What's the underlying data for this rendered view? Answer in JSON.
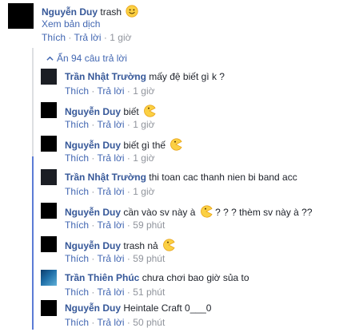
{
  "top_comment": {
    "author": "Nguyễn Duy",
    "text": "trash",
    "translate": "Xem bản dịch",
    "actions": {
      "like": "Thích",
      "reply": "Trả lời",
      "sep": "·",
      "time": "1 giờ"
    }
  },
  "thread": {
    "hidden_replies": "Ẩn 94 câu trả lời",
    "replies": [
      {
        "author": "Trần Nhật Trường",
        "text": "mấy đệ biết gì k ?",
        "emoji": "",
        "like": "Thích",
        "reply": "Trả lời",
        "time": "1 giờ"
      },
      {
        "author": "Nguyễn Duy",
        "text": "biết",
        "emoji": "pacman-emoji",
        "like": "Thích",
        "reply": "Trả lời",
        "time": "1 giờ"
      },
      {
        "author": "Nguyễn Duy",
        "text": "biết gì thế",
        "emoji": "pacman-emoji",
        "like": "Thích",
        "reply": "Trả lời",
        "time": "1 giờ"
      },
      {
        "author": "Trần Nhật Trường",
        "text": "thi toan cac thanh nien bi band acc",
        "emoji": "",
        "like": "Thích",
        "reply": "Trả lời",
        "time": "1 giờ"
      },
      {
        "author": "Nguyễn Duy",
        "text": "cần vào sv này à",
        "text_after": "? ? ? thèm sv này à ??",
        "emoji": "pacman-emoji",
        "like": "Thích",
        "reply": "Trả lời",
        "time": "59 phút"
      },
      {
        "author": "Nguyễn Duy",
        "text": "trash nả",
        "emoji": "pacman-emoji",
        "like": "Thích",
        "reply": "Trả lời",
        "time": "59 phút"
      },
      {
        "author": "Trần Thiên Phúc",
        "text": "chưa chơi bao giờ sủa to",
        "emoji": "",
        "like": "Thích",
        "reply": "Trả lời",
        "time": "51 phút"
      },
      {
        "author": "Nguyễn Duy",
        "text": "Heintale Craft 0___0",
        "emoji": "",
        "like": "Thích",
        "reply": "Trả lời",
        "time": "50 phút"
      }
    ]
  },
  "colors": {
    "link": "#365899",
    "meta": "#90949c",
    "highlight_rail": "#5b7bd5",
    "rail": "#dddfe2"
  }
}
